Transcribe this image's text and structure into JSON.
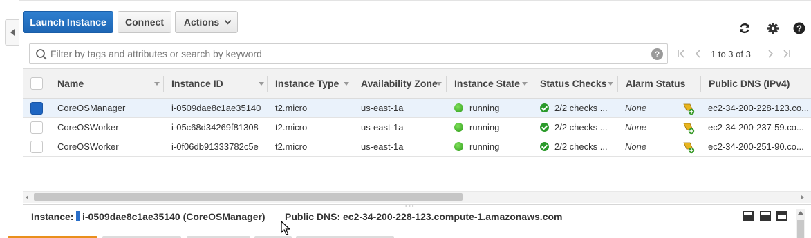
{
  "toolbar": {
    "launch_label": "Launch Instance",
    "connect_label": "Connect",
    "actions_label": "Actions"
  },
  "icons": {
    "refresh": "refresh-icon",
    "settings": "gear-icon",
    "help": "help-icon",
    "search": "search-icon"
  },
  "search": {
    "placeholder": "Filter by tags and attributes or search by keyword",
    "help_glyph": "?"
  },
  "pagination": {
    "text": "1 to 3 of 3"
  },
  "table": {
    "columns": [
      "Name",
      "Instance ID",
      "Instance Type",
      "Availability Zone",
      "Instance State",
      "Status Checks",
      "Alarm Status",
      "Public DNS (IPv4)"
    ],
    "rows": [
      {
        "selected": true,
        "name": "CoreOSManager",
        "instance_id": "i-0509dae8c1ae35140",
        "instance_type": "t2.micro",
        "az": "us-east-1a",
        "state": "running",
        "status_checks": "2/2 checks ...",
        "alarm_status": "None",
        "public_dns": "ec2-34-200-228-123.co..."
      },
      {
        "selected": false,
        "name": "CoreOSWorker",
        "instance_id": "i-05c68d34269f81308",
        "instance_type": "t2.micro",
        "az": "us-east-1a",
        "state": "running",
        "status_checks": "2/2 checks ...",
        "alarm_status": "None",
        "public_dns": "ec2-34-200-237-59.co..."
      },
      {
        "selected": false,
        "name": "CoreOSWorker",
        "instance_id": "i-0f06db91333782c5e",
        "instance_type": "t2.micro",
        "az": "us-east-1a",
        "state": "running",
        "status_checks": "2/2 checks ...",
        "alarm_status": "None",
        "public_dns": "ec2-34-200-251-90.co..."
      }
    ]
  },
  "details": {
    "instance_label": "Instance:",
    "instance_value": "i-0509dae8c1ae35140 (CoreOSManager)",
    "dns_label": "Public DNS:",
    "dns_value": "ec2-34-200-228-123.compute-1.amazonaws.com"
  },
  "colors": {
    "primary": "#1d66b5",
    "running": "#2d9a1b",
    "selected_row": "#eaf2fb",
    "detail_tab_active": "#e98f1c"
  }
}
